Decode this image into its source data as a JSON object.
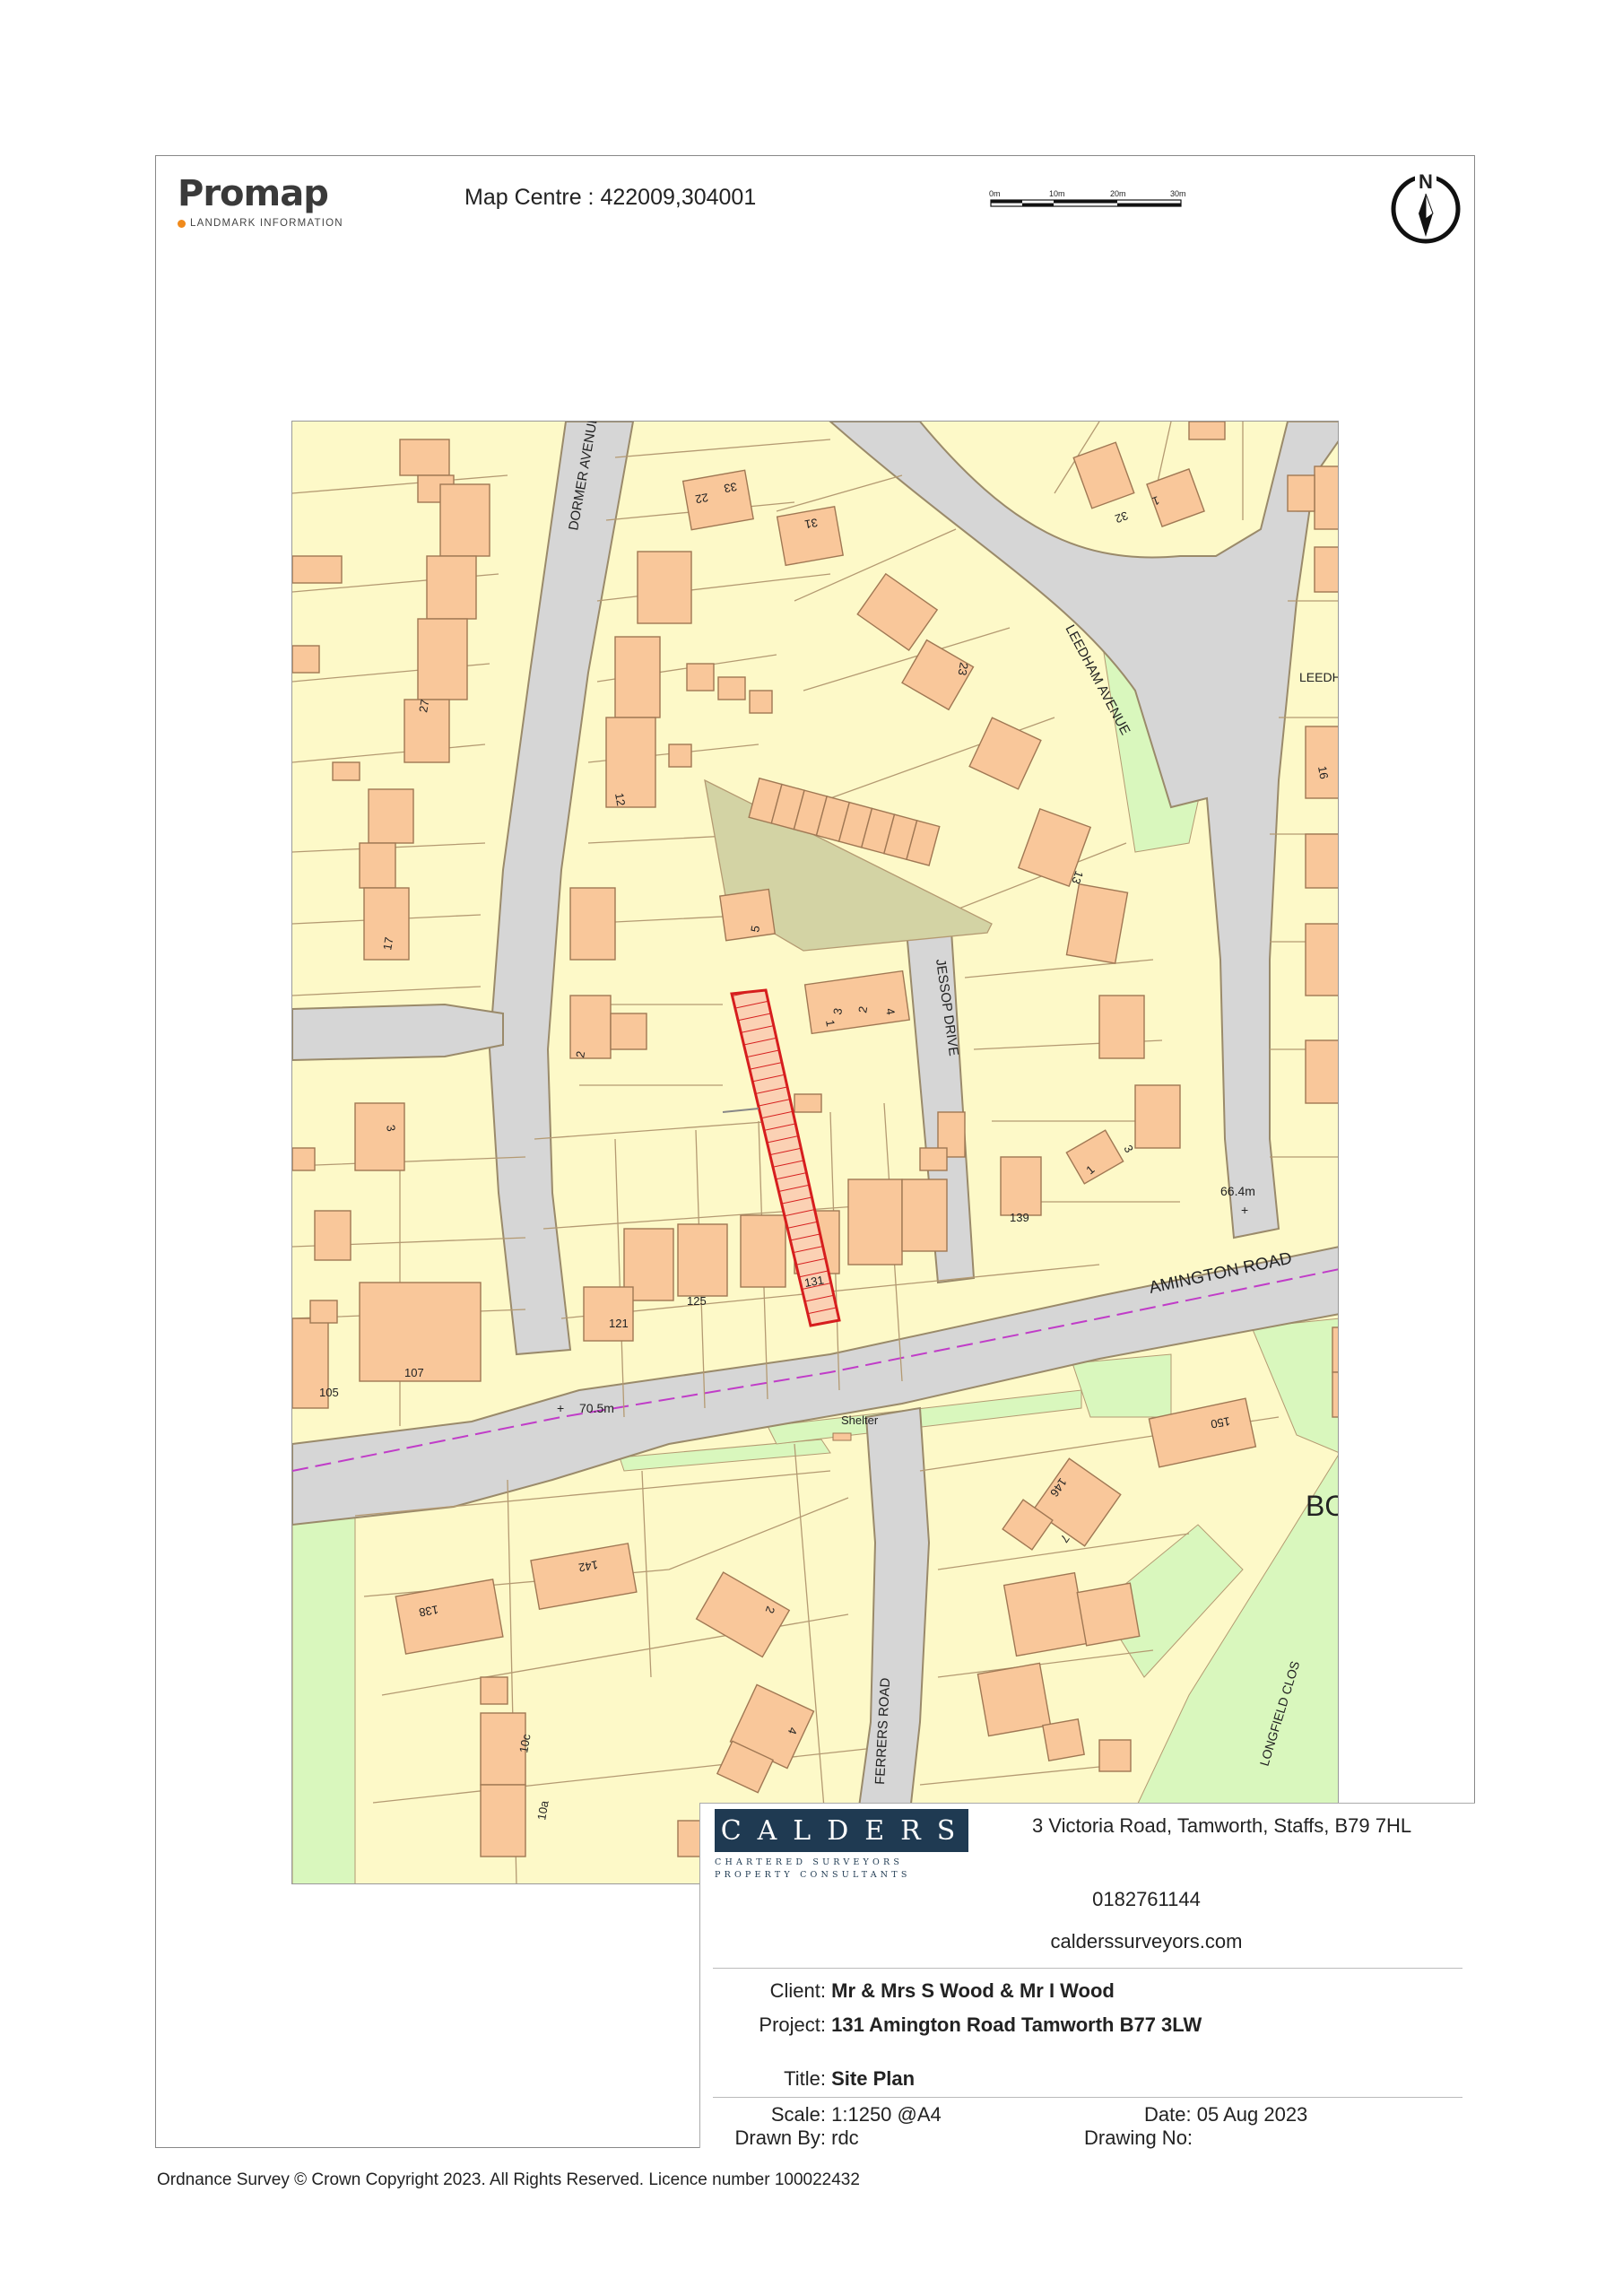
{
  "header": {
    "logo_word": "Promap",
    "logo_sub": "LANDMARK INFORMATION",
    "map_centre": "Map Centre : 422009,304001",
    "scale_ticks": [
      "0m",
      "10m",
      "20m",
      "30m"
    ],
    "north_label": "N"
  },
  "map": {
    "roads": [
      "DORMER AVENUE",
      "LEEDHAM AVENUE",
      "LEEDH",
      "JESSOP DRIVE",
      "AMINGTON ROAD",
      "FERRERS ROAD",
      "LONGFIELD CLOS"
    ],
    "spot_heights": [
      "66.4m",
      "70.5m"
    ],
    "features": [
      "Shelter",
      "BO"
    ],
    "house_numbers": [
      "33",
      "22",
      "31",
      "32",
      "1",
      "23",
      "27",
      "12",
      "16",
      "13",
      "5",
      "17",
      "1",
      "3",
      "2",
      "4",
      "2",
      "3",
      "1",
      "3",
      "139",
      "131",
      "125",
      "121",
      "107",
      "105",
      "150",
      "146",
      "7",
      "138",
      "142",
      "2",
      "10c",
      "10a",
      "4"
    ],
    "colors": {
      "land": "#fdf9c8",
      "building": "#f9c79a",
      "road": "#d6d6d6",
      "green": "#d9f7bd",
      "boundary": "#b49a72",
      "site": "#d61e1e",
      "parish_line": "#c03cc8"
    }
  },
  "titleblock": {
    "company": "CALDERS",
    "tag1": "CHARTERED SURVEYORS",
    "tag2": "PROPERTY CONSULTANTS",
    "address": "3 Victoria Road, Tamworth, Staffs, B79 7HL",
    "phone": "0182761144",
    "website": "calderssurveyors.com",
    "client_label": "Client:",
    "client": "Mr & Mrs S Wood & Mr I Wood",
    "project_label": "Project:",
    "project": "131 Amington Road Tamworth B77 3LW",
    "title_label": "Title:",
    "title": "Site Plan",
    "scale_label": "Scale:",
    "scale": "1:1250 @A4",
    "date_label": "Date:",
    "date": "05 Aug 2023",
    "drawn_label": "Drawn By:",
    "drawn": "rdc",
    "drawing_no_label": "Drawing No:",
    "drawing_no": ""
  },
  "footer": {
    "copyright": "Ordnance Survey © Crown Copyright 2023. All Rights Reserved. Licence number 100022432"
  }
}
